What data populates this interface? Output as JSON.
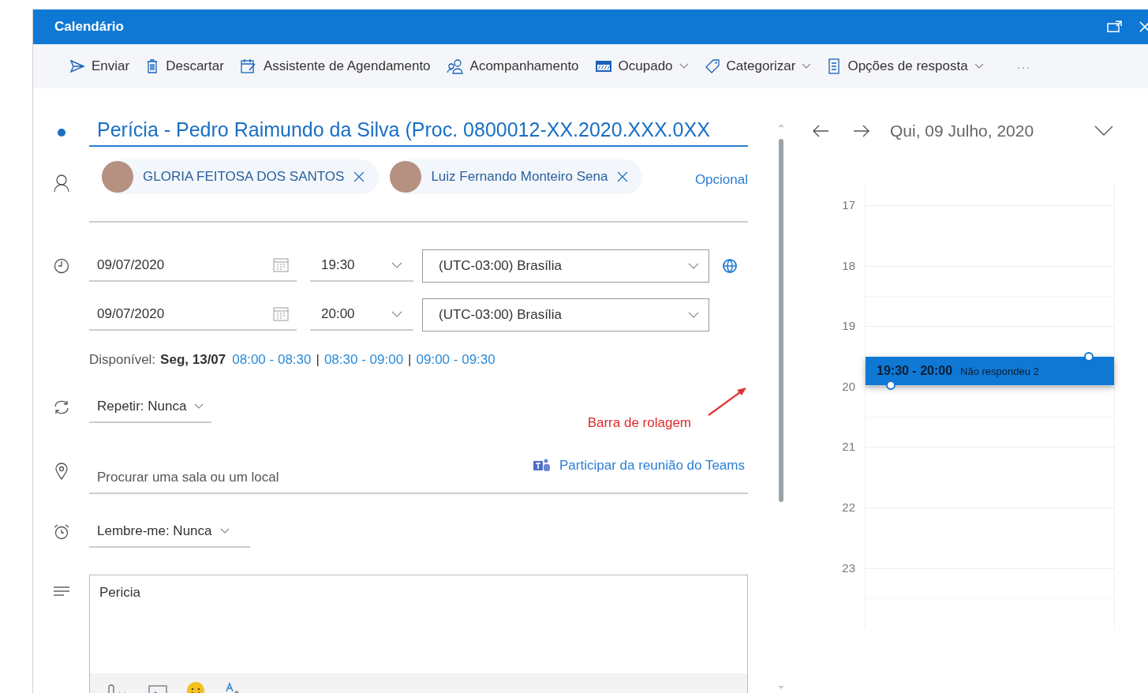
{
  "window": {
    "title": "Calendário"
  },
  "toolbar": [
    {
      "kind": "send",
      "label": "Enviar",
      "dropdown": false
    },
    {
      "kind": "trash",
      "label": "Descartar",
      "dropdown": false
    },
    {
      "kind": "scheduler",
      "label": "Assistente de Agendamento",
      "dropdown": false
    },
    {
      "kind": "people",
      "label": "Acompanhamento",
      "dropdown": false
    },
    {
      "kind": "busy",
      "label": "Ocupado",
      "dropdown": true
    },
    {
      "kind": "tag",
      "label": "Categorizar",
      "dropdown": true
    },
    {
      "kind": "reply",
      "label": "Opções de resposta",
      "dropdown": true
    },
    {
      "kind": "more",
      "label": "···",
      "dropdown": false
    }
  ],
  "event_title": "Perícia - Pedro Raimundo da Silva (Proc. 0800012-XX.2020.XXX.0XX",
  "attendees": [
    {
      "name": "GLORIA FEITOSA DOS SANTOS"
    },
    {
      "name": "Luiz Fernando Monteiro Sena"
    }
  ],
  "optional_link": "Opcional",
  "start": {
    "date": "09/07/2020",
    "time": "19:30",
    "timezone": "(UTC-03:00) Brasília"
  },
  "end": {
    "date": "09/07/2020",
    "time": "20:00",
    "timezone": "(UTC-03:00) Brasília"
  },
  "availability": {
    "label": "Disponível:",
    "day": "Seg, 13/07",
    "slots": [
      "08:00 - 08:30",
      "08:30 - 09:00",
      "09:00 - 09:30"
    ],
    "separator": "|"
  },
  "repeat": "Repetir: Nunca",
  "annotation": "Barra de rolagem",
  "location": {
    "placeholder": "Procurar uma sala ou um local"
  },
  "teams_link": "Participar da reunião do Teams",
  "reminder": "Lembre-me: Nunca",
  "body": "Pericia",
  "calendar": {
    "date": "Qui, 09 Julho, 2020",
    "hours": [
      {
        "label": "17"
      },
      {
        "label": "18"
      },
      {
        "label": "19",
        "event": {
          "time": "19:30 - 20:00",
          "status": "Não respondeu 2"
        }
      },
      {
        "label": "20"
      },
      {
        "label": "21"
      },
      {
        "label": "22"
      },
      {
        "label": "23"
      }
    ]
  }
}
